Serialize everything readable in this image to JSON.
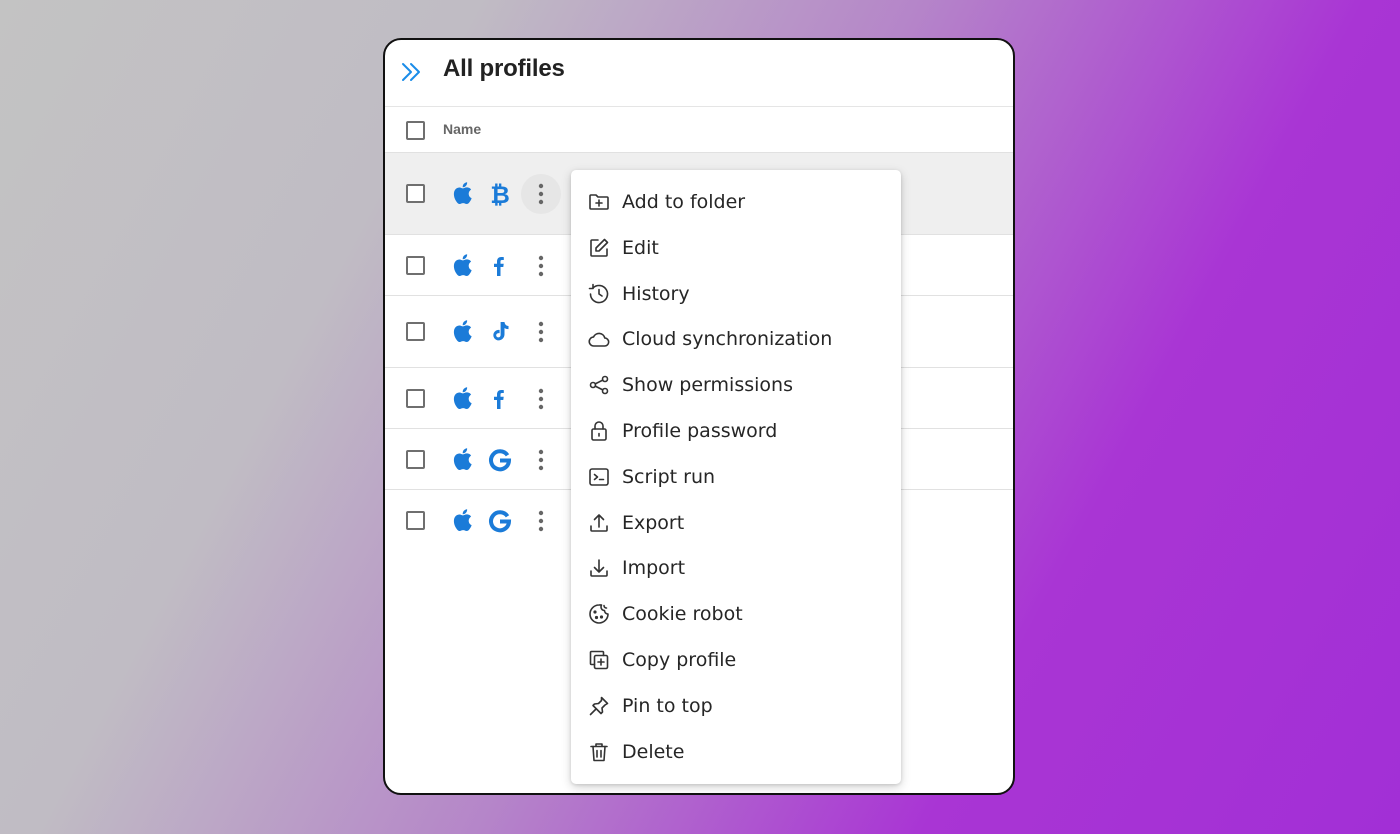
{
  "header": {
    "title": "All profiles"
  },
  "table": {
    "column_name": "Name",
    "rows": [
      {
        "os": "apple-icon",
        "site": "bitcoin-icon",
        "selected": true
      },
      {
        "os": "apple-icon",
        "site": "facebook-icon",
        "selected": false
      },
      {
        "os": "apple-icon",
        "site": "tiktok-icon",
        "selected": false
      },
      {
        "os": "apple-icon",
        "site": "facebook-icon",
        "selected": false
      },
      {
        "os": "apple-icon",
        "site": "google-icon",
        "selected": false
      },
      {
        "os": "apple-icon",
        "site": "google-icon",
        "selected": false
      }
    ]
  },
  "menu": {
    "items": [
      {
        "label": "Add to folder",
        "icon": "folder-plus-icon"
      },
      {
        "label": "Edit",
        "icon": "pencil-icon"
      },
      {
        "label": "History",
        "icon": "history-icon"
      },
      {
        "label": "Cloud synchronization",
        "icon": "cloud-icon"
      },
      {
        "label": "Show permissions",
        "icon": "share-icon"
      },
      {
        "label": "Profile password",
        "icon": "lock-icon"
      },
      {
        "label": "Script run",
        "icon": "terminal-icon"
      },
      {
        "label": "Export",
        "icon": "upload-icon"
      },
      {
        "label": "Import",
        "icon": "download-icon"
      },
      {
        "label": "Cookie robot",
        "icon": "cookie-icon"
      },
      {
        "label": "Copy profile",
        "icon": "copy-icon"
      },
      {
        "label": "Pin to top",
        "icon": "pin-icon"
      },
      {
        "label": "Delete",
        "icon": "trash-icon"
      }
    ]
  },
  "colors": {
    "accent": "#1a73e8",
    "icon_stroke": "#333333"
  }
}
